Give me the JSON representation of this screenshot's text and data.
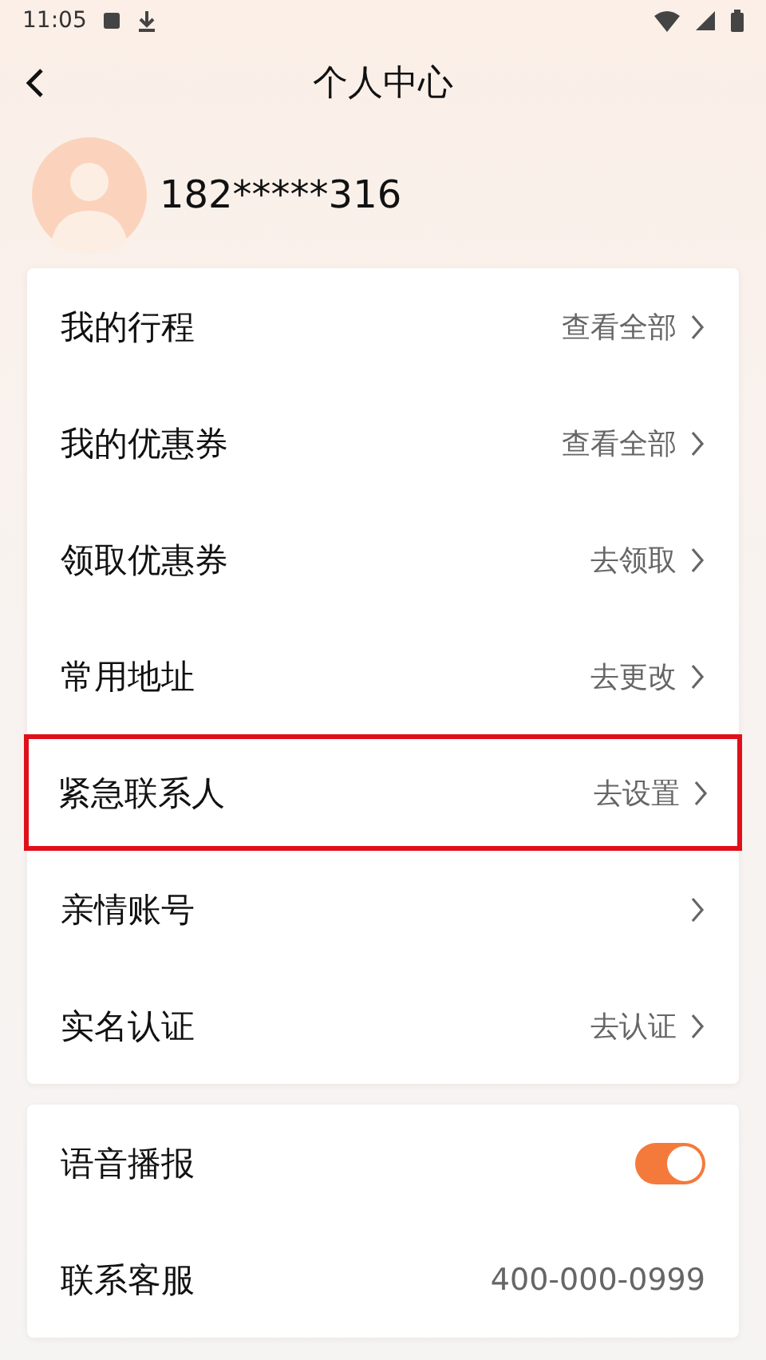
{
  "status_bar": {
    "time": "11:05"
  },
  "header": {
    "title": "个人中心"
  },
  "profile": {
    "phone": "182*****316"
  },
  "menu": [
    {
      "label": "我的行程",
      "action": "查看全部",
      "highlighted": false
    },
    {
      "label": "我的优惠券",
      "action": "查看全部",
      "highlighted": false
    },
    {
      "label": "领取优惠券",
      "action": "去领取",
      "highlighted": false
    },
    {
      "label": "常用地址",
      "action": "去更改",
      "highlighted": false
    },
    {
      "label": "紧急联系人",
      "action": "去设置",
      "highlighted": true
    },
    {
      "label": "亲情账号",
      "highlighted": false
    },
    {
      "label": "实名认证",
      "action": "去认证",
      "highlighted": false
    }
  ],
  "settings": [
    {
      "kind": "toggle",
      "label": "语音播报",
      "on": true
    },
    {
      "kind": "text",
      "label": "联系客服",
      "value": "400-000-0999"
    }
  ]
}
